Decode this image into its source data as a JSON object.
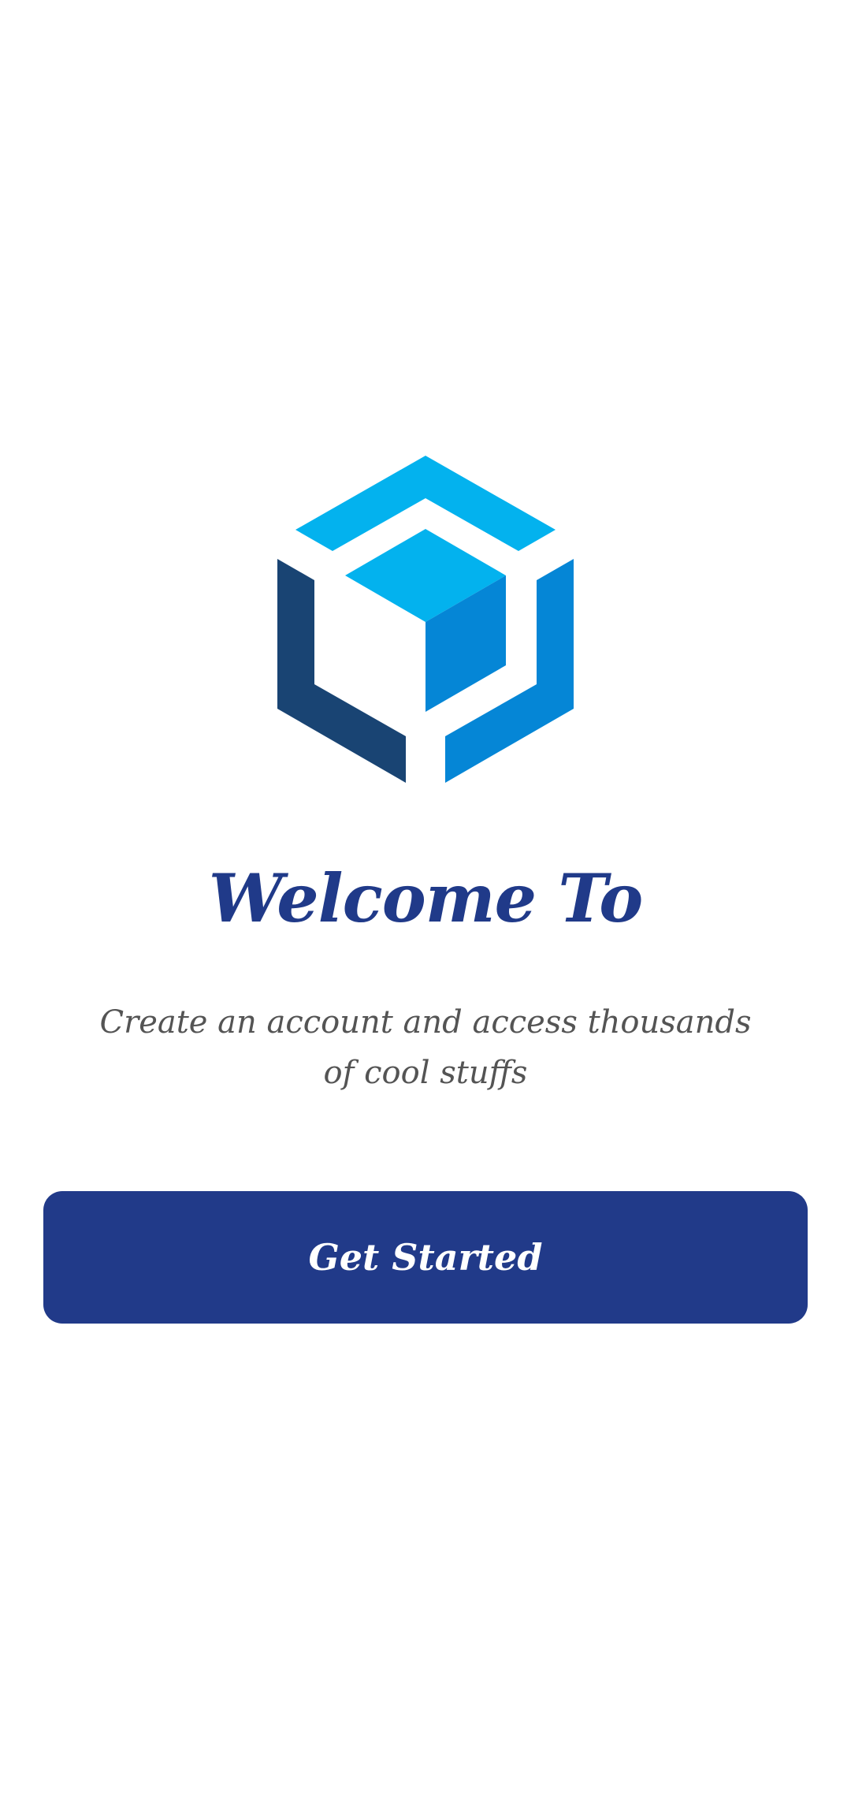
{
  "welcome": {
    "logo_icon": "cube-logo-icon",
    "title": "Welcome To",
    "subtitle": "Create an account and access thousands of cool stuffs",
    "cta_label": "Get Started"
  },
  "colors": {
    "primary": "#213a89",
    "logo_light": "#03b2ee",
    "logo_mid": "#0586d6",
    "logo_dark": "#194473",
    "subtitle_text": "#545454",
    "background": "#ffffff"
  }
}
